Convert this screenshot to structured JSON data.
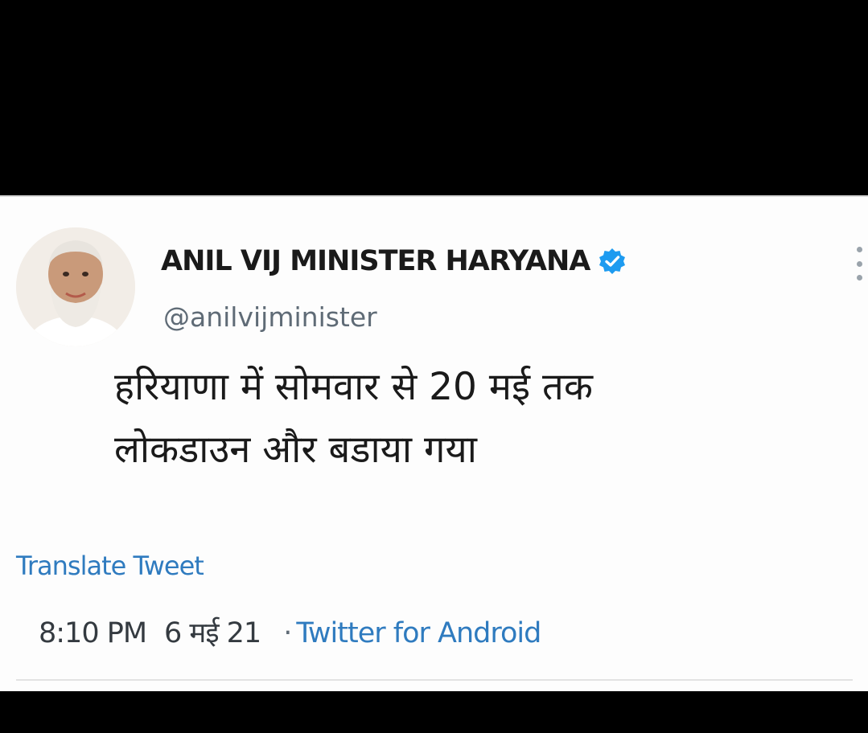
{
  "tweet": {
    "display_name": "ANIL VIJ MINISTER HARYANA",
    "handle": "@anilvijminister",
    "verified_icon": "verified-badge-icon",
    "text_line1": "हरियाणा में सोमवार से 20 मई तक",
    "text_line2": "लोकडाउन और बडाया गया",
    "translate_label": "Translate Tweet",
    "time": "8:10 PM",
    "date": "6 मई 21",
    "separator": "·",
    "source": "Twitter for Android"
  },
  "colors": {
    "link": "#2f7bbf",
    "verified": "#1d9bf0",
    "background": "#000000",
    "card": "#fdfdfd"
  }
}
